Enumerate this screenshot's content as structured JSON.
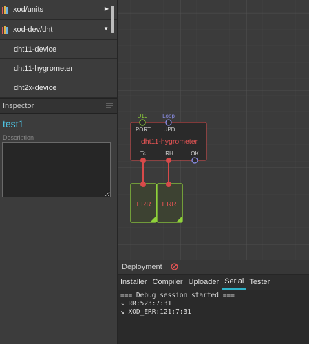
{
  "library": {
    "items": [
      {
        "label": "xod/units",
        "expanded": false
      },
      {
        "label": "xod-dev/dht",
        "expanded": true
      }
    ],
    "sub_items": [
      "dht11-device",
      "dht11-hygrometer",
      "dht2x-device"
    ]
  },
  "inspector": {
    "title": "Inspector",
    "node_label": "test1",
    "description_label": "Description",
    "description_value": ""
  },
  "canvas": {
    "node": {
      "title": "dht11-hygrometer",
      "inputs": [
        {
          "name": "PORT",
          "value": "D10"
        },
        {
          "name": "UPD",
          "value": "Loop"
        }
      ],
      "outputs": [
        "Tc",
        "RH",
        "OK"
      ]
    },
    "watches": [
      "ERR",
      "ERR"
    ]
  },
  "deployment": {
    "title": "Deployment",
    "tabs": [
      "Installer",
      "Compiler",
      "Uploader",
      "Serial",
      "Tester"
    ],
    "active_tab": "Serial",
    "console": [
      "=== Debug session started ===",
      "↘ RR:523:7:31",
      "↘ XOD_ERR:121:7:31"
    ]
  },
  "colors": {
    "accent": "#2fb3c9",
    "node_border": "#d84a4a",
    "watch_border": "#8fd23a",
    "error_text": "#e55454"
  }
}
